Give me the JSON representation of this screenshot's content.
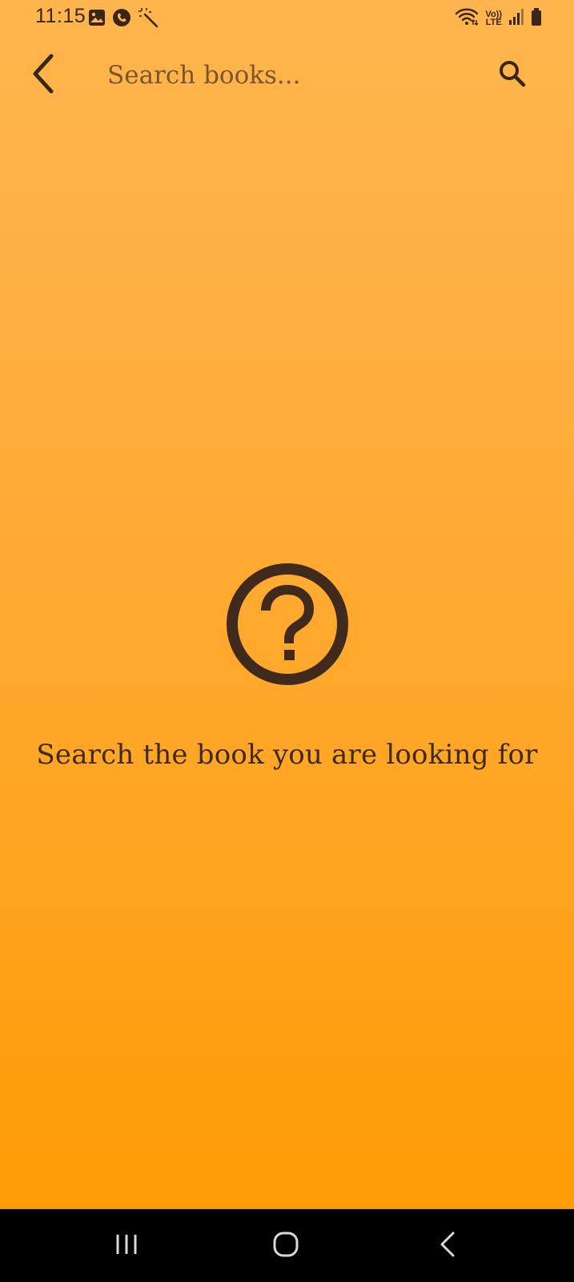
{
  "status_bar": {
    "time": "11:15",
    "left_icons": [
      "gallery-icon",
      "messenger-icon",
      "magic-wand-icon"
    ],
    "right_icons": [
      "wifi-icon",
      "volte-icon",
      "signal-icon",
      "battery-icon"
    ],
    "volte_top": "Vo))",
    "volte_bottom": "LTE"
  },
  "app_bar": {
    "back_icon": "arrow-back-icon",
    "search_placeholder": "Search books...",
    "search_value": "",
    "search_icon": "search-icon"
  },
  "empty_state": {
    "icon": "help-circle-icon",
    "message": "Search the book you are looking for"
  },
  "nav_bar": {
    "recents_icon": "recents-icon",
    "home_icon": "home-icon",
    "back_icon": "back-icon"
  },
  "colors": {
    "background_top": "#FFB54D",
    "background_bottom": "#FF9C05",
    "foreground": "#3f2a1c",
    "nav_background": "#000000"
  }
}
